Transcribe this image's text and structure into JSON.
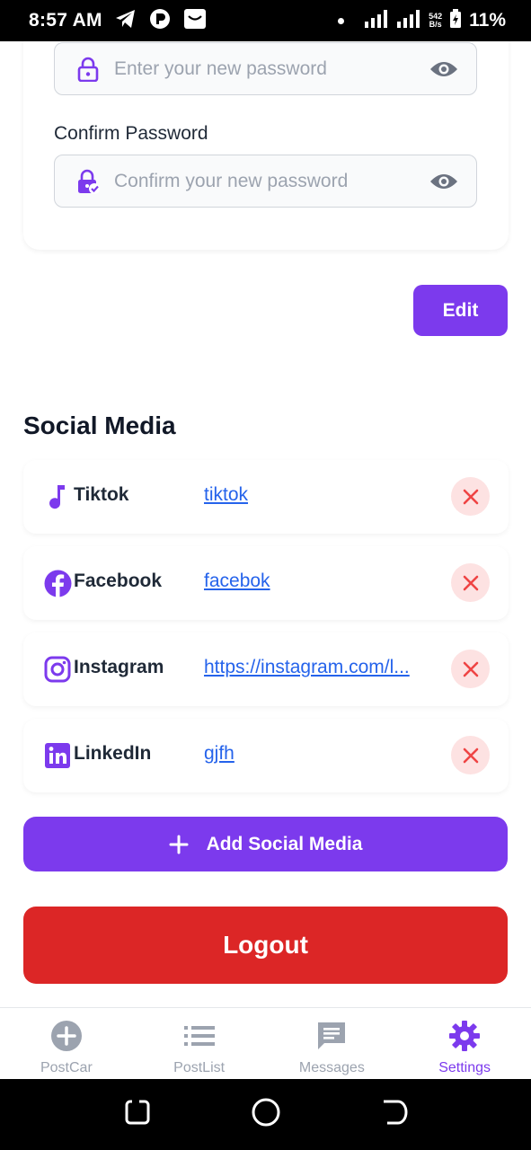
{
  "status_bar": {
    "time": "8:57 AM",
    "net_speed_value": "542",
    "net_speed_unit": "B/s",
    "battery": "11%"
  },
  "password_section": {
    "new_password_placeholder": "Enter your new password",
    "confirm_label": "Confirm Password",
    "confirm_placeholder": "Confirm your new password"
  },
  "edit_button": "Edit",
  "social_section": {
    "title": "Social Media",
    "items": [
      {
        "icon": "music-note-icon",
        "name": "Tiktok",
        "link": "tiktok"
      },
      {
        "icon": "facebook-icon",
        "name": "Facebook",
        "link": "facebok"
      },
      {
        "icon": "instagram-icon",
        "name": "Instagram",
        "link": "https://instagram.com/l..."
      },
      {
        "icon": "linkedin-icon",
        "name": "LinkedIn",
        "link": "gjfh"
      }
    ],
    "add_button": "Add Social Media"
  },
  "logout_button": "Logout",
  "tabs": [
    {
      "icon": "add-circle-icon",
      "label": "PostCar",
      "active": false
    },
    {
      "icon": "list-icon",
      "label": "PostList",
      "active": false
    },
    {
      "icon": "message-icon",
      "label": "Messages",
      "active": false
    },
    {
      "icon": "gear-icon",
      "label": "Settings",
      "active": true
    }
  ],
  "colors": {
    "primary": "#7c3aed",
    "danger": "#dc2626",
    "link": "#2563eb",
    "muted": "#9ca3af"
  }
}
